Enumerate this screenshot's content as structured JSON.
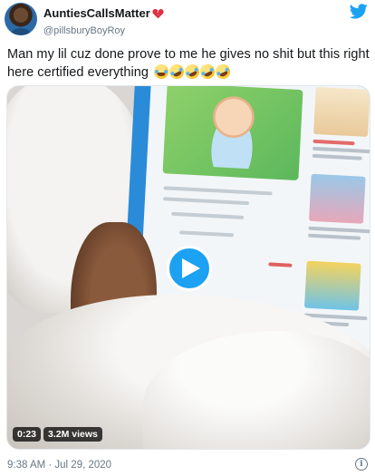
{
  "user": {
    "display_name": "AuntiesCallsMatter",
    "handle": "@pillsburyBoyRoy",
    "name_emoji": "broken-heart-icon"
  },
  "tweet": {
    "text": "Man my lil cuz done prove to me he gives no shit but this right here certified everything",
    "emojis": [
      "face-with-tears-of-joy-icon",
      "rolling-on-the-floor-laughing-icon",
      "rolling-on-the-floor-laughing-icon",
      "rolling-on-the-floor-laughing-icon",
      "rolling-on-the-floor-laughing-icon"
    ]
  },
  "media": {
    "duration": "0:23",
    "views": "3.2M views"
  },
  "footer": {
    "timestamp": "9:38 AM · Jul 29, 2020"
  },
  "colors": {
    "twitter_blue": "#1da1f2",
    "text_primary": "#14171a",
    "text_secondary": "#657786"
  }
}
